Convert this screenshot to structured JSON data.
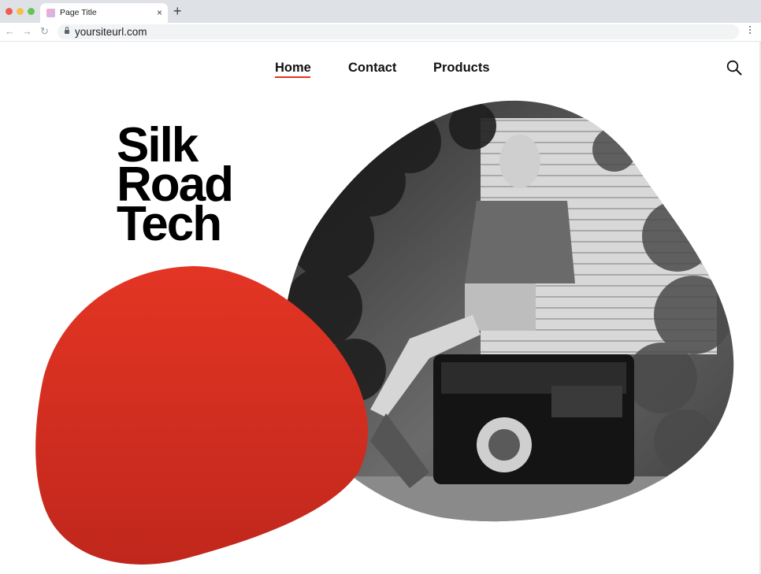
{
  "browser": {
    "tab_title": "Page Title",
    "tab_close": "×",
    "new_tab": "+",
    "url": "yoursiteurl.com",
    "back": "←",
    "forward": "→",
    "reload": "↻"
  },
  "nav": {
    "items": [
      "Home",
      "Contact",
      "Products"
    ],
    "active": "Home"
  },
  "search": {
    "icon": "search-icon"
  },
  "hero": {
    "title_lines": [
      "Silk",
      "Road",
      "Tech"
    ]
  },
  "colors": {
    "accent": "#e33524",
    "tabbar": "#dee1e6"
  }
}
